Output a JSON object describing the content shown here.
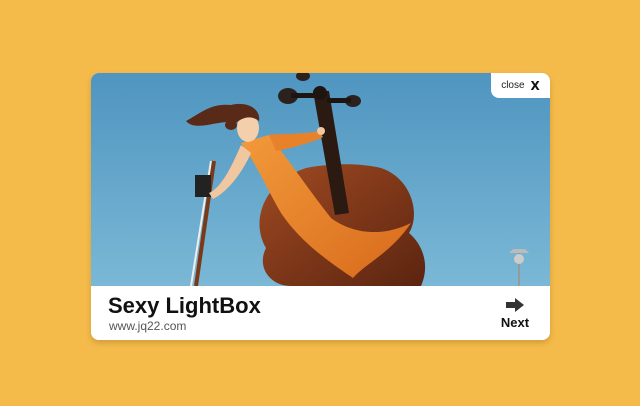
{
  "lightbox": {
    "image": {
      "alt_icon": "illustration-cellist-woman"
    },
    "close": {
      "label": "close",
      "icon": "X"
    },
    "caption": {
      "title": "Sexy LightBox",
      "subtitle": "www.jq22.com"
    },
    "next": {
      "label": "Next",
      "icon": "arrow-right-icon"
    }
  },
  "colors": {
    "page_background": "#f4bb4b",
    "sky": "#5fa3cb",
    "dress": "#e8822a",
    "cello": "#8a3a1a"
  }
}
